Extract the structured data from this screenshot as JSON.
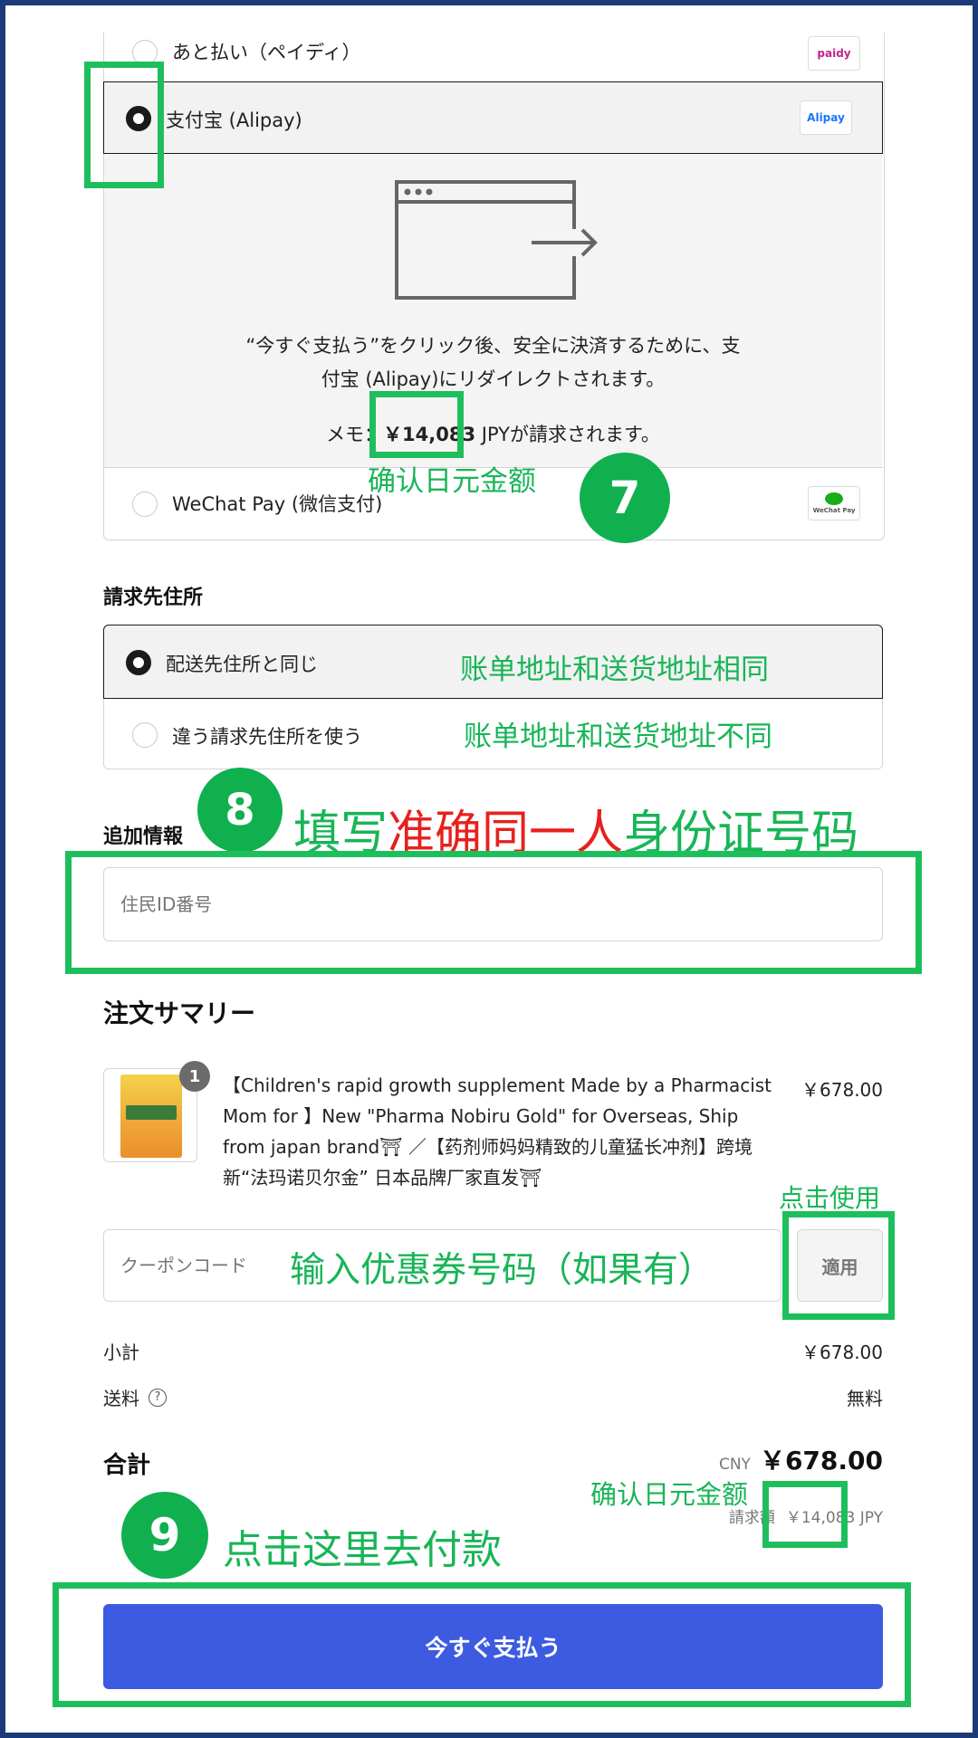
{
  "payment": {
    "paidy_label": "あと払い（ペイディ）",
    "paidy_logo": "paidy",
    "alipay_label": "支付宝 (Alipay)",
    "alipay_logo": "Alipay",
    "redirect_text_1": "“今すぐ支払う”をクリック後、安全に決済するために、支",
    "redirect_text_2": "付宝 (Alipay)にリダイレクトされます。",
    "memo_prefix": "メモ：",
    "memo_amount": "￥14,083",
    "memo_suffix": " JPYが請求されます。",
    "wechat_label": "WeChat Pay (微信支付)",
    "wechat_logo": "WeChat Pay"
  },
  "billing": {
    "title": "請求先住所",
    "same_label": "配送先住所と同じ",
    "different_label": "違う請求先住所を使う"
  },
  "additional": {
    "title": "追加情報",
    "id_placeholder": "住民ID番号"
  },
  "summary": {
    "title": "注文サマリー",
    "item_qty": "1",
    "item_name_1": "【Children's rapid growth supplement Made by a Pharmacist",
    "item_name_2": "Mom for 】New \"Pharma Nobiru Gold\" for Overseas, Ship",
    "item_name_3": "from japan brand⛩ ／【药剂师妈妈精致的儿童猛长冲剂】跨境",
    "item_name_4": "新“法玛诺贝尔金” 日本品牌厂家直发⛩",
    "item_price": "￥678.00",
    "coupon_placeholder": "クーポンコード",
    "apply_label": "適用",
    "subtotal_label": "小計",
    "subtotal_value": "￥678.00",
    "shipping_label": "送料",
    "shipping_value": "無料",
    "total_label": "合計",
    "total_currency": "CNY",
    "total_value": "￥678.00",
    "charged_label": "請求額",
    "charged_value": "￥14,083 JPY",
    "pay_button": "今すぐ支払う"
  },
  "annotations": {
    "confirm_yen_1": "确认日元金额",
    "step7": "7",
    "same_address_note": "账单地址和送货地址相同",
    "diff_address_note": "账单地址和送货地址不同",
    "step8": "8",
    "id_note_a": "填写",
    "id_note_b": "准确同一人",
    "id_note_c": "身份证号码",
    "click_use": "点击使用",
    "coupon_note": "输入优惠券号码（如果有）",
    "confirm_yen_2": "确认日元金额",
    "step9": "9",
    "pay_note": "点击这里去付款"
  },
  "colors": {
    "pay_button": "#3d5be0",
    "annotation_green": "#18b557",
    "annotation_red": "#e8201e",
    "frame": "#1d3a78"
  }
}
